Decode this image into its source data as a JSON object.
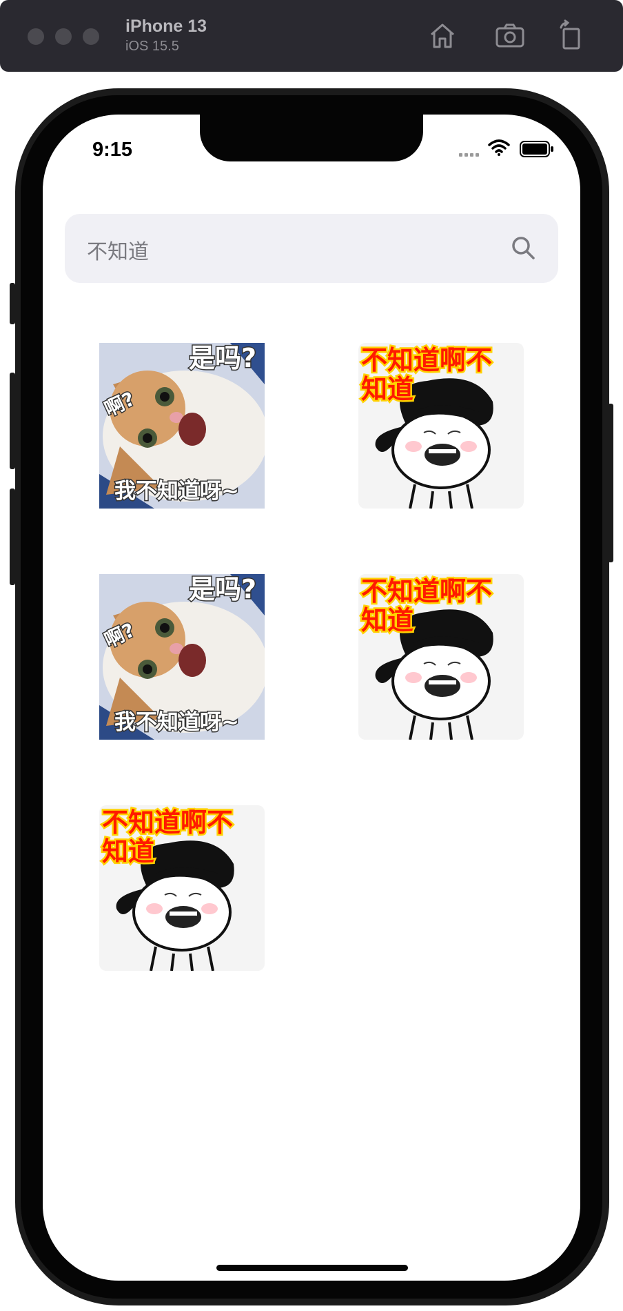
{
  "simulator": {
    "device_name": "iPhone 13",
    "os_version": "iOS 15.5",
    "icons": [
      "home-icon",
      "screenshot-icon",
      "rotate-icon"
    ]
  },
  "status_bar": {
    "time": "9:15",
    "icons": [
      "signal-icon",
      "wifi-icon",
      "battery-icon"
    ]
  },
  "search": {
    "query": "不知道",
    "icon": "search-icon"
  },
  "results": [
    {
      "type": "cat-meme",
      "captions": [
        "是吗?",
        "啊?",
        "我不知道呀~"
      ]
    },
    {
      "type": "cartoon-meme",
      "captions": [
        "不知道啊不",
        "知道"
      ]
    },
    {
      "type": "cat-meme",
      "captions": [
        "是吗?",
        "啊?",
        "我不知道呀~"
      ]
    },
    {
      "type": "cartoon-meme",
      "captions": [
        "不知道啊不",
        "知道"
      ]
    },
    {
      "type": "cartoon-meme",
      "captions": [
        "不知道啊不",
        "知道"
      ]
    }
  ]
}
